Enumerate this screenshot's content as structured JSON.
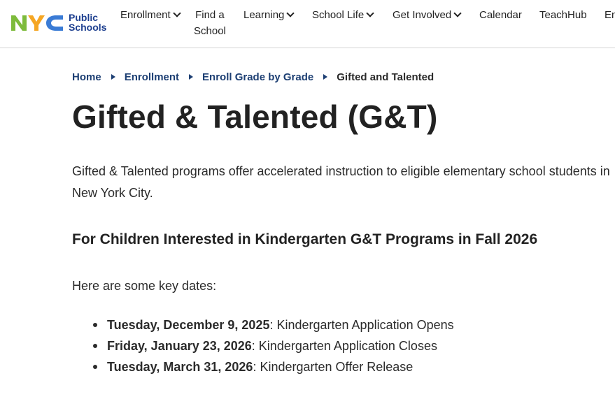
{
  "logo": {
    "letters": "NYC",
    "line1": "Public",
    "line2": "Schools",
    "colors": {
      "n": "#7dbb3b",
      "y": "#f5a623",
      "c": "#3a7bd5",
      "text": "#1d3f8f"
    }
  },
  "nav": {
    "items": [
      {
        "label": "Enrollment",
        "has_menu": true
      },
      {
        "label_line1": "Find a",
        "label_line2": "School",
        "has_menu": false
      },
      {
        "label": "Learning",
        "has_menu": true
      },
      {
        "label": "School Life",
        "has_menu": true
      },
      {
        "label": "Get Involved",
        "has_menu": true
      },
      {
        "label": "Calendar",
        "has_menu": false
      },
      {
        "label": "TeachHub",
        "has_menu": false
      },
      {
        "label": "En",
        "has_menu": false
      }
    ]
  },
  "breadcrumb": {
    "items": [
      "Home",
      "Enrollment",
      "Enroll Grade by Grade"
    ],
    "current": "Gifted and Talented"
  },
  "page": {
    "title": "Gifted & Talented (G&T)",
    "intro": "Gifted & Talented programs offer accelerated instruction to eligible elementary school students in New York City.",
    "section_heading": "For Children Interested in Kindergarten G&T Programs in Fall 2026",
    "key_dates_intro": "Here are some key dates:",
    "key_dates": [
      {
        "date": "Tuesday, December 9, 2025",
        "event": ": Kindergarten Application Opens"
      },
      {
        "date": "Friday, January 23, 2026",
        "event": ": Kindergarten Application Closes"
      },
      {
        "date": "Tuesday, March 31, 2026",
        "event": ": Kindergarten Offer Release"
      }
    ]
  },
  "colors": {
    "link": "#1d3f73",
    "text": "#2b2b2b"
  }
}
